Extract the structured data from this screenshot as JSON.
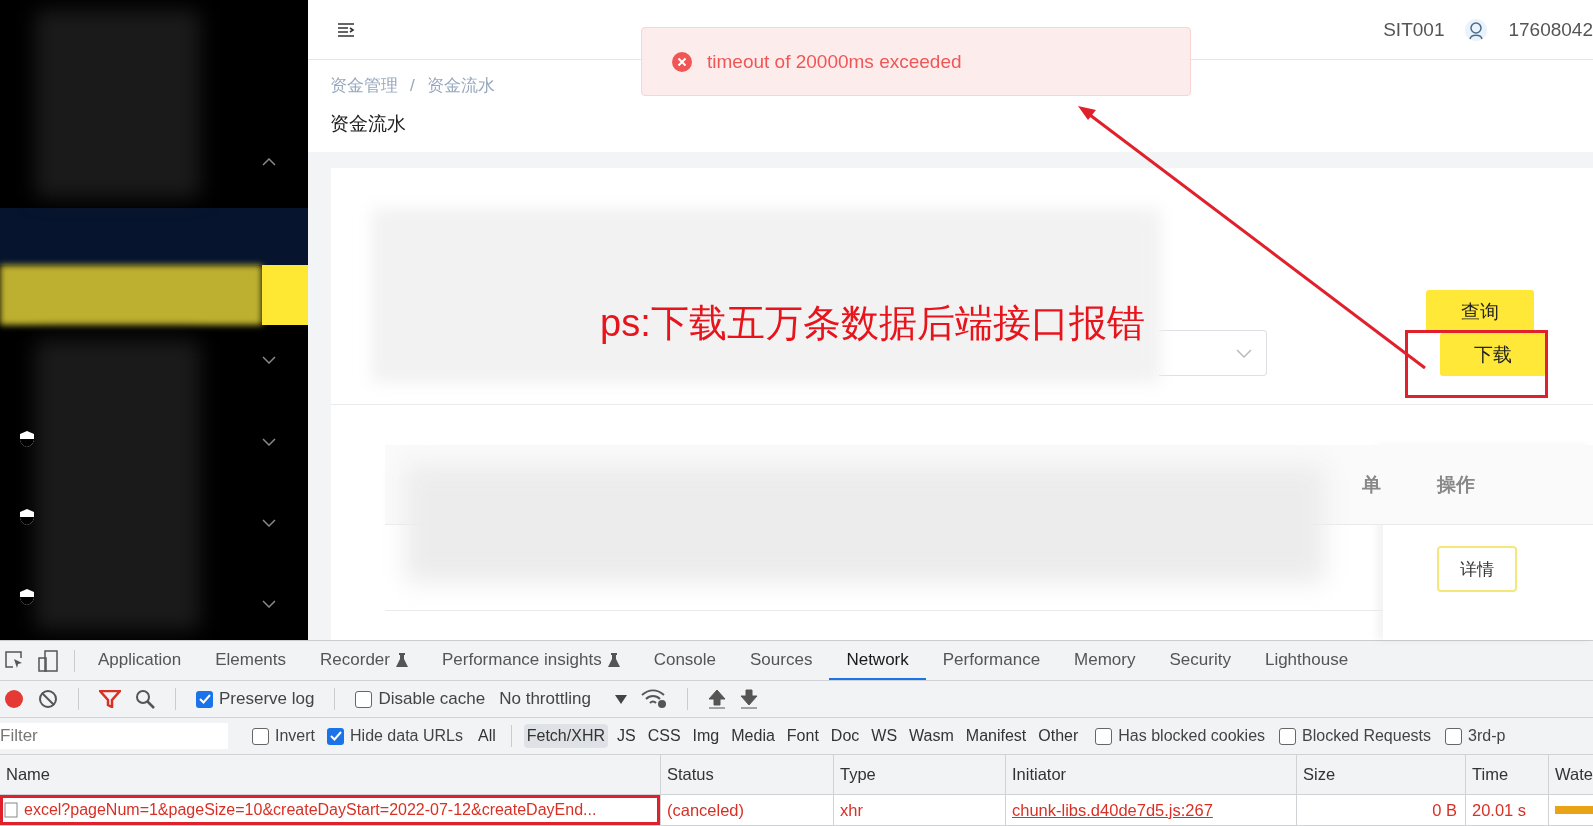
{
  "header": {
    "account": "SIT001",
    "user": "17608042"
  },
  "toast": {
    "kind": "error",
    "message": "timeout of 20000ms exceeded"
  },
  "breadcrumb": {
    "items": [
      "资金管理",
      "资金流水"
    ],
    "separator": "/"
  },
  "page_title": "资金流水",
  "annotation": "ps:下载五万条数据后端接口报错",
  "buttons": [
    {
      "label": "查询",
      "boxed": false
    },
    {
      "label": "下载",
      "boxed": true
    }
  ],
  "table": {
    "columns": [
      "单",
      "操作"
    ],
    "rows": [
      {
        "action": "详情"
      }
    ]
  },
  "devtools": {
    "tabs": [
      {
        "label": "Application",
        "experimental": false,
        "selected": false
      },
      {
        "label": "Elements",
        "experimental": false,
        "selected": false
      },
      {
        "label": "Recorder",
        "experimental": true,
        "selected": false
      },
      {
        "label": "Performance insights",
        "experimental": true,
        "selected": false
      },
      {
        "label": "Console",
        "experimental": false,
        "selected": false
      },
      {
        "label": "Sources",
        "experimental": false,
        "selected": false
      },
      {
        "label": "Network",
        "experimental": false,
        "selected": true
      },
      {
        "label": "Performance",
        "experimental": false,
        "selected": false
      },
      {
        "label": "Memory",
        "experimental": false,
        "selected": false
      },
      {
        "label": "Security",
        "experimental": false,
        "selected": false
      },
      {
        "label": "Lighthouse",
        "experimental": false,
        "selected": false
      }
    ],
    "recording": true,
    "preserve_log": {
      "label": "Preserve log",
      "checked": true
    },
    "disable_cache": {
      "label": "Disable cache",
      "checked": false
    },
    "throttling": "No throttling",
    "filter": {
      "placeholder": "Filter"
    },
    "options": [
      {
        "label": "Invert",
        "checked": false
      },
      {
        "label": "Hide data URLs",
        "checked": true
      }
    ],
    "types": [
      {
        "label": "All",
        "selected": false
      },
      {
        "label": "Fetch/XHR",
        "selected": true
      },
      {
        "label": "JS",
        "selected": false
      },
      {
        "label": "CSS",
        "selected": false
      },
      {
        "label": "Img",
        "selected": false
      },
      {
        "label": "Media",
        "selected": false
      },
      {
        "label": "Font",
        "selected": false
      },
      {
        "label": "Doc",
        "selected": false
      },
      {
        "label": "WS",
        "selected": false
      },
      {
        "label": "Wasm",
        "selected": false
      },
      {
        "label": "Manifest",
        "selected": false
      },
      {
        "label": "Other",
        "selected": false
      }
    ],
    "extra_filters": [
      {
        "label": "Has blocked cookies",
        "checked": false
      },
      {
        "label": "Blocked Requests",
        "checked": false
      },
      {
        "label": "3rd-p",
        "checked": false
      }
    ],
    "columns": [
      "Name",
      "Status",
      "Type",
      "Initiator",
      "Size",
      "Time",
      "Wate"
    ],
    "requests": [
      {
        "name": "excel?pageNum=1&pageSize=10&createDayStart=2022-07-12&createDayEnd...",
        "status": "(canceled)",
        "type": "xhr",
        "initiator": "chunk-libs.d40de7d5.js:267",
        "size": "0 B",
        "time": "20.01 s",
        "boxed": true
      }
    ]
  }
}
